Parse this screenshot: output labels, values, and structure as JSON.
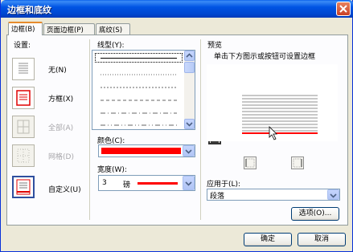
{
  "window": {
    "title": "边框和底纹"
  },
  "tabs": [
    {
      "label": "边框(B)"
    },
    {
      "label": "页面边框(P)"
    },
    {
      "label": "底纹(S)"
    }
  ],
  "settings": {
    "heading": "设置:",
    "items": [
      {
        "label": "无(N)"
      },
      {
        "label": "方框(X)"
      },
      {
        "label": "全部(A)"
      },
      {
        "label": "网格(D)"
      },
      {
        "label": "自定义(U)"
      }
    ]
  },
  "line_style": {
    "label": "线型(Y):"
  },
  "color": {
    "label": "颜色(C):",
    "value_color": "#ff0000"
  },
  "width": {
    "label": "宽度(W):",
    "value": "3",
    "unit": "磅"
  },
  "preview": {
    "heading": "预览",
    "hint": "单击下方图示或按钮可设置边框"
  },
  "apply_to": {
    "label": "应用于(L):",
    "value": "段落"
  },
  "options_button": "选项(O)...",
  "ok_button": "确定",
  "cancel_button": "取消",
  "colors": {
    "accent_border": "#ff0000",
    "title_bar": "#0054e3"
  }
}
